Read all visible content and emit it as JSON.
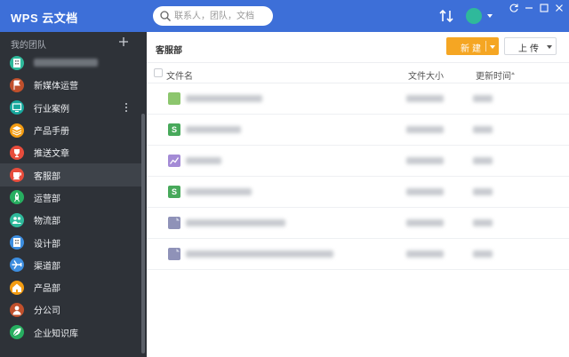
{
  "app": {
    "title": "WPS 云文档"
  },
  "search": {
    "placeholder": "联系人，团队，文档"
  },
  "user": {
    "avatar_initial": ""
  },
  "colors": {
    "topbar": "#3d6fd8",
    "sidebar": "#2e3238",
    "accent_new": "#f5a623"
  },
  "sidebar": {
    "header": "我的团队",
    "items": [
      {
        "label": "",
        "color": "#2fb99b",
        "icon": "building-icon",
        "blurred": true
      },
      {
        "label": "新媒体运营",
        "color": "#c0502c",
        "icon": "flag-icon"
      },
      {
        "label": "行业案例",
        "color": "#17a79c",
        "icon": "monitor-icon",
        "has_more": true
      },
      {
        "label": "产品手册",
        "color": "#f39c12",
        "icon": "layers-icon"
      },
      {
        "label": "推送文章",
        "color": "#e74c3c",
        "icon": "trophy-icon"
      },
      {
        "label": "客服部",
        "color": "#e74c3c",
        "icon": "cup-icon",
        "active": true
      },
      {
        "label": "运营部",
        "color": "#27ae60",
        "icon": "rocket-icon"
      },
      {
        "label": "物流部",
        "color": "#2fb99b",
        "icon": "people-icon"
      },
      {
        "label": "设计部",
        "color": "#3d8ee0",
        "icon": "building-icon"
      },
      {
        "label": "渠道部",
        "color": "#3d8ee0",
        "icon": "plane-icon"
      },
      {
        "label": "产品部",
        "color": "#f39c12",
        "icon": "home-icon"
      },
      {
        "label": "分公司",
        "color": "#c0502c",
        "icon": "person-icon"
      },
      {
        "label": "企业知识库",
        "color": "#27ae60",
        "icon": "leaf-icon"
      }
    ]
  },
  "main": {
    "breadcrumb": "客服部",
    "new_label": "新建",
    "upload_label": "上传",
    "columns": {
      "name": "文件名",
      "size": "文件大小",
      "time": "更新时间"
    },
    "files": [
      {
        "type": "document",
        "icon": "doc-green-icon",
        "color": "#8cc66d",
        "glyph": ""
      },
      {
        "type": "spreadsheet",
        "icon": "sheet-icon",
        "color": "#48a95b",
        "glyph": "S"
      },
      {
        "type": "chart",
        "icon": "chart-icon",
        "color": "#a48bd6",
        "glyph": ""
      },
      {
        "type": "spreadsheet",
        "icon": "sheet-icon",
        "color": "#48a95b",
        "glyph": "S"
      },
      {
        "type": "file",
        "icon": "file-icon",
        "color": "#8f92b8",
        "glyph": ""
      },
      {
        "type": "file",
        "icon": "file-icon",
        "color": "#8f92b8",
        "glyph": ""
      }
    ]
  }
}
